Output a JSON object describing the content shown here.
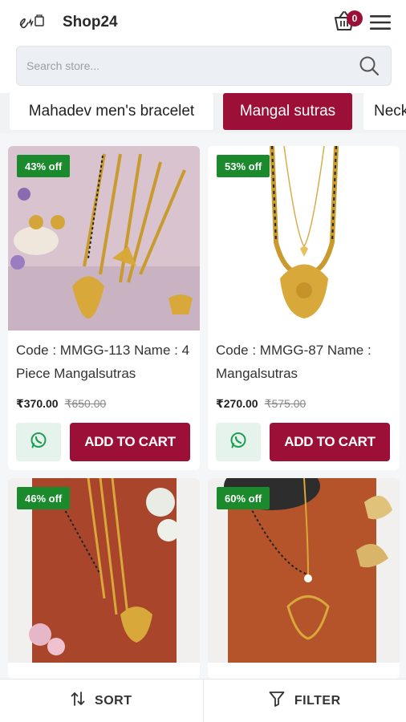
{
  "header": {
    "title": "Shop24",
    "cart_count": "0",
    "logo_icon": "shop-logo-icon",
    "cart_icon": "shopping-basket-icon",
    "menu_icon": "hamburger-menu-icon"
  },
  "search": {
    "placeholder": "Search store...",
    "value": "",
    "icon": "search-icon"
  },
  "categories": [
    {
      "label": "Mahadev men's bracelet",
      "active": false
    },
    {
      "label": "Mangal sutras",
      "active": true
    },
    {
      "label": "Neck",
      "active": false
    }
  ],
  "products": [
    {
      "discount": "43% off",
      "name": "Code : MMGG-113 Name : 4 Piece Mangalsutras",
      "price": "₹370.00",
      "mrp": "₹650.00",
      "add_to_cart": "ADD TO CART",
      "whatsapp_icon": "whatsapp-icon"
    },
    {
      "discount": "53% off",
      "name": "Code : MMGG-87 Name : Mangalsutras",
      "price": "₹270.00",
      "mrp": "₹575.00",
      "add_to_cart": "ADD TO CART",
      "whatsapp_icon": "whatsapp-icon"
    },
    {
      "discount": "46% off"
    },
    {
      "discount": "60% off"
    }
  ],
  "bottom_bar": {
    "sort_label": "SORT",
    "filter_label": "FILTER",
    "sort_icon": "sort-arrows-icon",
    "filter_icon": "filter-funnel-icon"
  },
  "colors": {
    "brand": "#9c1038",
    "discount": "#1b8a2c",
    "whatsapp": "#1f9d55"
  }
}
